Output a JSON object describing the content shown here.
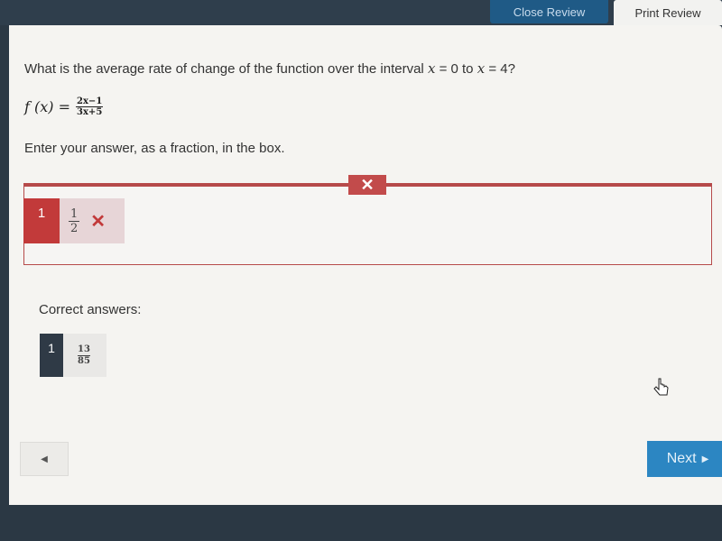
{
  "header": {
    "close_review_label": "Close Review",
    "print_review_label": "Print Review"
  },
  "question": {
    "text_prefix": "What is the average rate of change of the function over the interval ",
    "var1": "x",
    "mid1": " = 0 to ",
    "var2": "x",
    "mid2": " = 4?",
    "function_lhs": "f (x) =",
    "function_numerator": "2x−1",
    "function_denominator": "3x+5",
    "instruction": "Enter your answer, as a fraction, in the box."
  },
  "response": {
    "status_icon": "x-icon",
    "status_symbol": "✕",
    "index": "1",
    "numerator": "1",
    "denominator": "2",
    "marker_symbol": "✕",
    "status_color": "#c23a3a"
  },
  "correct": {
    "label": "Correct answers:",
    "index": "1",
    "numerator": "13",
    "denominator": "85"
  },
  "navigation": {
    "prev_symbol": "◀",
    "next_label": "Next",
    "next_symbol": "▶",
    "accent_color": "#2c86c2"
  }
}
